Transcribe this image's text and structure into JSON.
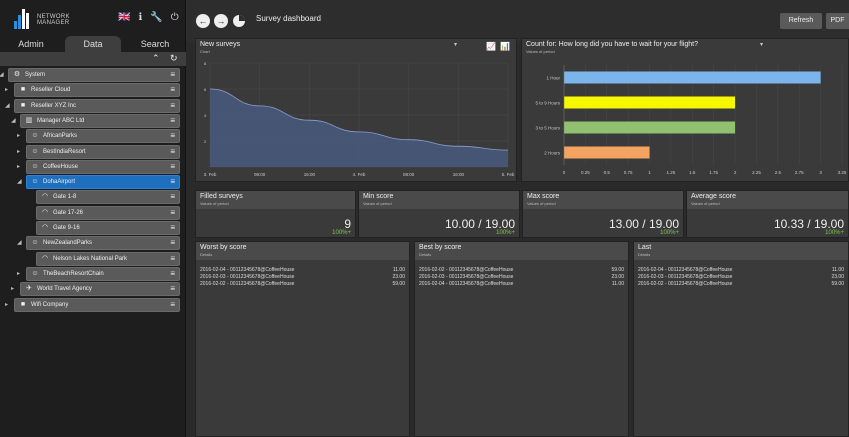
{
  "app": {
    "logo_text_1": "NETWORK",
    "logo_text_2": "MANAGER",
    "flag": "🇬🇧",
    "icons": [
      "flag-icon",
      "info-icon",
      "wrench-icon",
      "power-icon"
    ]
  },
  "sidebar": {
    "tabs": [
      "Admin",
      "Data",
      "Search"
    ],
    "active_tab": "Data",
    "tree": [
      {
        "label": "System",
        "depth": 0,
        "icon": "gear-icon"
      },
      {
        "label": "Reseller Cloud",
        "depth": 1,
        "icon": "folder-icon"
      },
      {
        "label": "Reseller XYZ Inc",
        "depth": 1,
        "icon": "folder-icon"
      },
      {
        "label": "Manager ABC Ltd",
        "depth": 2,
        "icon": "building-icon"
      },
      {
        "label": "AfricanParks",
        "depth": 3,
        "icon": "users-icon"
      },
      {
        "label": "BestIndiaResort",
        "depth": 3,
        "icon": "users-icon"
      },
      {
        "label": "CoffeeHouse",
        "depth": 3,
        "icon": "users-icon"
      },
      {
        "label": "DohaAirport",
        "depth": 3,
        "icon": "users-icon",
        "selected": true
      },
      {
        "label": "Gate 1-8",
        "depth": 4,
        "icon": "wifi-icon"
      },
      {
        "label": "Gate 17-26",
        "depth": 4,
        "icon": "wifi-icon"
      },
      {
        "label": "Gate 9-16",
        "depth": 4,
        "icon": "wifi-icon"
      },
      {
        "label": "NewZealandParks",
        "depth": 3,
        "icon": "users-icon"
      },
      {
        "label": "Nelson Lakes National Park",
        "depth": 4,
        "icon": "wifi-icon"
      },
      {
        "label": "TheBeachResortChain",
        "depth": 3,
        "icon": "users-icon"
      },
      {
        "label": "World Travel Agency",
        "depth": 2,
        "icon": "plane-icon"
      },
      {
        "label": "Wifi Company",
        "depth": 1,
        "icon": "folder-icon"
      }
    ]
  },
  "header": {
    "title": "Survey dashboard",
    "refresh": "Refresh",
    "pdf": "PDF"
  },
  "panels": {
    "new_surveys": {
      "title": "New surveys",
      "subtitle": "Chart"
    },
    "wait": {
      "title": "Count for: How long did you have to wait for your flight?",
      "subtitle": "Values of period"
    },
    "filled": {
      "title": "Filled surveys",
      "subtitle": "Values of period",
      "value": "9",
      "pct": "100%+"
    },
    "min": {
      "title": "Min score",
      "subtitle": "Values of period",
      "value": "10.00 / 19.00",
      "pct": "100%+"
    },
    "max": {
      "title": "Max score",
      "subtitle": "Values of period",
      "value": "13.00 / 19.00",
      "pct": "100%+"
    },
    "avg": {
      "title": "Average score",
      "subtitle": "Values of period",
      "value": "10.33 / 19.00",
      "pct": "100%+"
    },
    "worst": {
      "title": "Worst by score",
      "subtitle": "Details",
      "rows": [
        {
          "k": "2016-02-04 - 00112345678@CoffeeHouse",
          "v": "11.00"
        },
        {
          "k": "2016-02-03 - 00112345678@CoffeeHouse",
          "v": "23.00"
        },
        {
          "k": "2016-02-02 - 00112345678@CoffeeHouse",
          "v": "59.00"
        }
      ]
    },
    "best": {
      "title": "Best by score",
      "subtitle": "Details",
      "rows": [
        {
          "k": "2016-02-02 - 00112345678@CoffeeHouse",
          "v": "59.00"
        },
        {
          "k": "2016-02-03 - 00112345678@CoffeeHouse",
          "v": "23.00"
        },
        {
          "k": "2016-02-04 - 00112345678@CoffeeHouse",
          "v": "11.00"
        }
      ]
    },
    "last": {
      "title": "Last",
      "subtitle": "Details",
      "rows": [
        {
          "k": "2016-02-04 - 00112345678@CoffeeHouse",
          "v": "11.00"
        },
        {
          "k": "2016-02-03 - 00112345678@CoffeeHouse",
          "v": "23.00"
        },
        {
          "k": "2016-02-02 - 00112345678@CoffeeHouse",
          "v": "59.00"
        }
      ]
    }
  },
  "chart_data": [
    {
      "type": "area",
      "x": [
        "3. Feb",
        "08:00",
        "16:00",
        "4. Feb",
        "08:00",
        "16:00",
        "5. Feb"
      ],
      "values": [
        6.0,
        4.7,
        3.6,
        2.7,
        2.1,
        1.6,
        1.3
      ],
      "ylim": [
        0,
        8
      ],
      "yticks": [
        0,
        2,
        4,
        6,
        8
      ],
      "color": "#4a5a80"
    },
    {
      "type": "bar",
      "orientation": "horizontal",
      "categories": [
        "1 Hour",
        "5 to 9 Hours",
        "3 to 5 Hours",
        "2 Hours"
      ],
      "values": [
        3,
        2,
        2,
        1
      ],
      "colors": [
        "#7cb5ec",
        "#f7f700",
        "#90c070",
        "#f4a460"
      ],
      "xlim": [
        0,
        3.25
      ],
      "xticks": [
        "0",
        "0.25",
        "0.5",
        "0.75",
        "1",
        "1.25",
        "1.5",
        "1.75",
        "2",
        "2.25",
        "2.5",
        "2.75",
        "3",
        "3.25"
      ]
    }
  ]
}
